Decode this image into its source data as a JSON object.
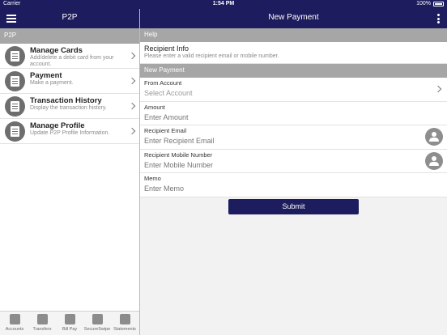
{
  "status_bar": {
    "carrier": "Carrier",
    "time": "1:54 PM",
    "battery": "100%"
  },
  "left_nav": {
    "title": "P2P"
  },
  "right_nav": {
    "title": "New Payment"
  },
  "sidebar": {
    "section_title": "P2P",
    "items": [
      {
        "title": "Manage Cards",
        "desc": "Add/delete a debit card from your account."
      },
      {
        "title": "Payment",
        "desc": "Make a payment."
      },
      {
        "title": "Transaction History",
        "desc": "Display the transaction history."
      },
      {
        "title": "Manage Profile",
        "desc": "Update P2P Profile Information."
      }
    ]
  },
  "tabs": [
    {
      "label": "Accounts",
      "icon": "credit-card-icon"
    },
    {
      "label": "Transfers",
      "icon": "transfer-arrows-icon"
    },
    {
      "label": "Bill Pay",
      "icon": "calculator-icon"
    },
    {
      "label": "SecureSwipe",
      "icon": "shield-lock-icon"
    },
    {
      "label": "Statements",
      "icon": "document-icon"
    }
  ],
  "form": {
    "help_section": "Help",
    "recipient_info_title": "Recipient Info",
    "recipient_info_desc": "Please enter a valid recipient email or mobile number.",
    "payment_section": "New Payment",
    "from_account": {
      "label": "From Account",
      "placeholder": "Select Account"
    },
    "amount": {
      "label": "Amount",
      "placeholder": "Enter Amount"
    },
    "recipient_email": {
      "label": "Recipient Email",
      "placeholder": "Enter Recipient Email"
    },
    "recipient_mobile": {
      "label": "Recipient Mobile Number",
      "placeholder": "Enter Mobile Number"
    },
    "memo": {
      "label": "Memo",
      "placeholder": "Enter Memo"
    },
    "submit_label": "Submit"
  },
  "colors": {
    "navbar": "#1c1c5e",
    "section_header": "#a6a6a6",
    "icon_circle": "#6e6e6e"
  }
}
